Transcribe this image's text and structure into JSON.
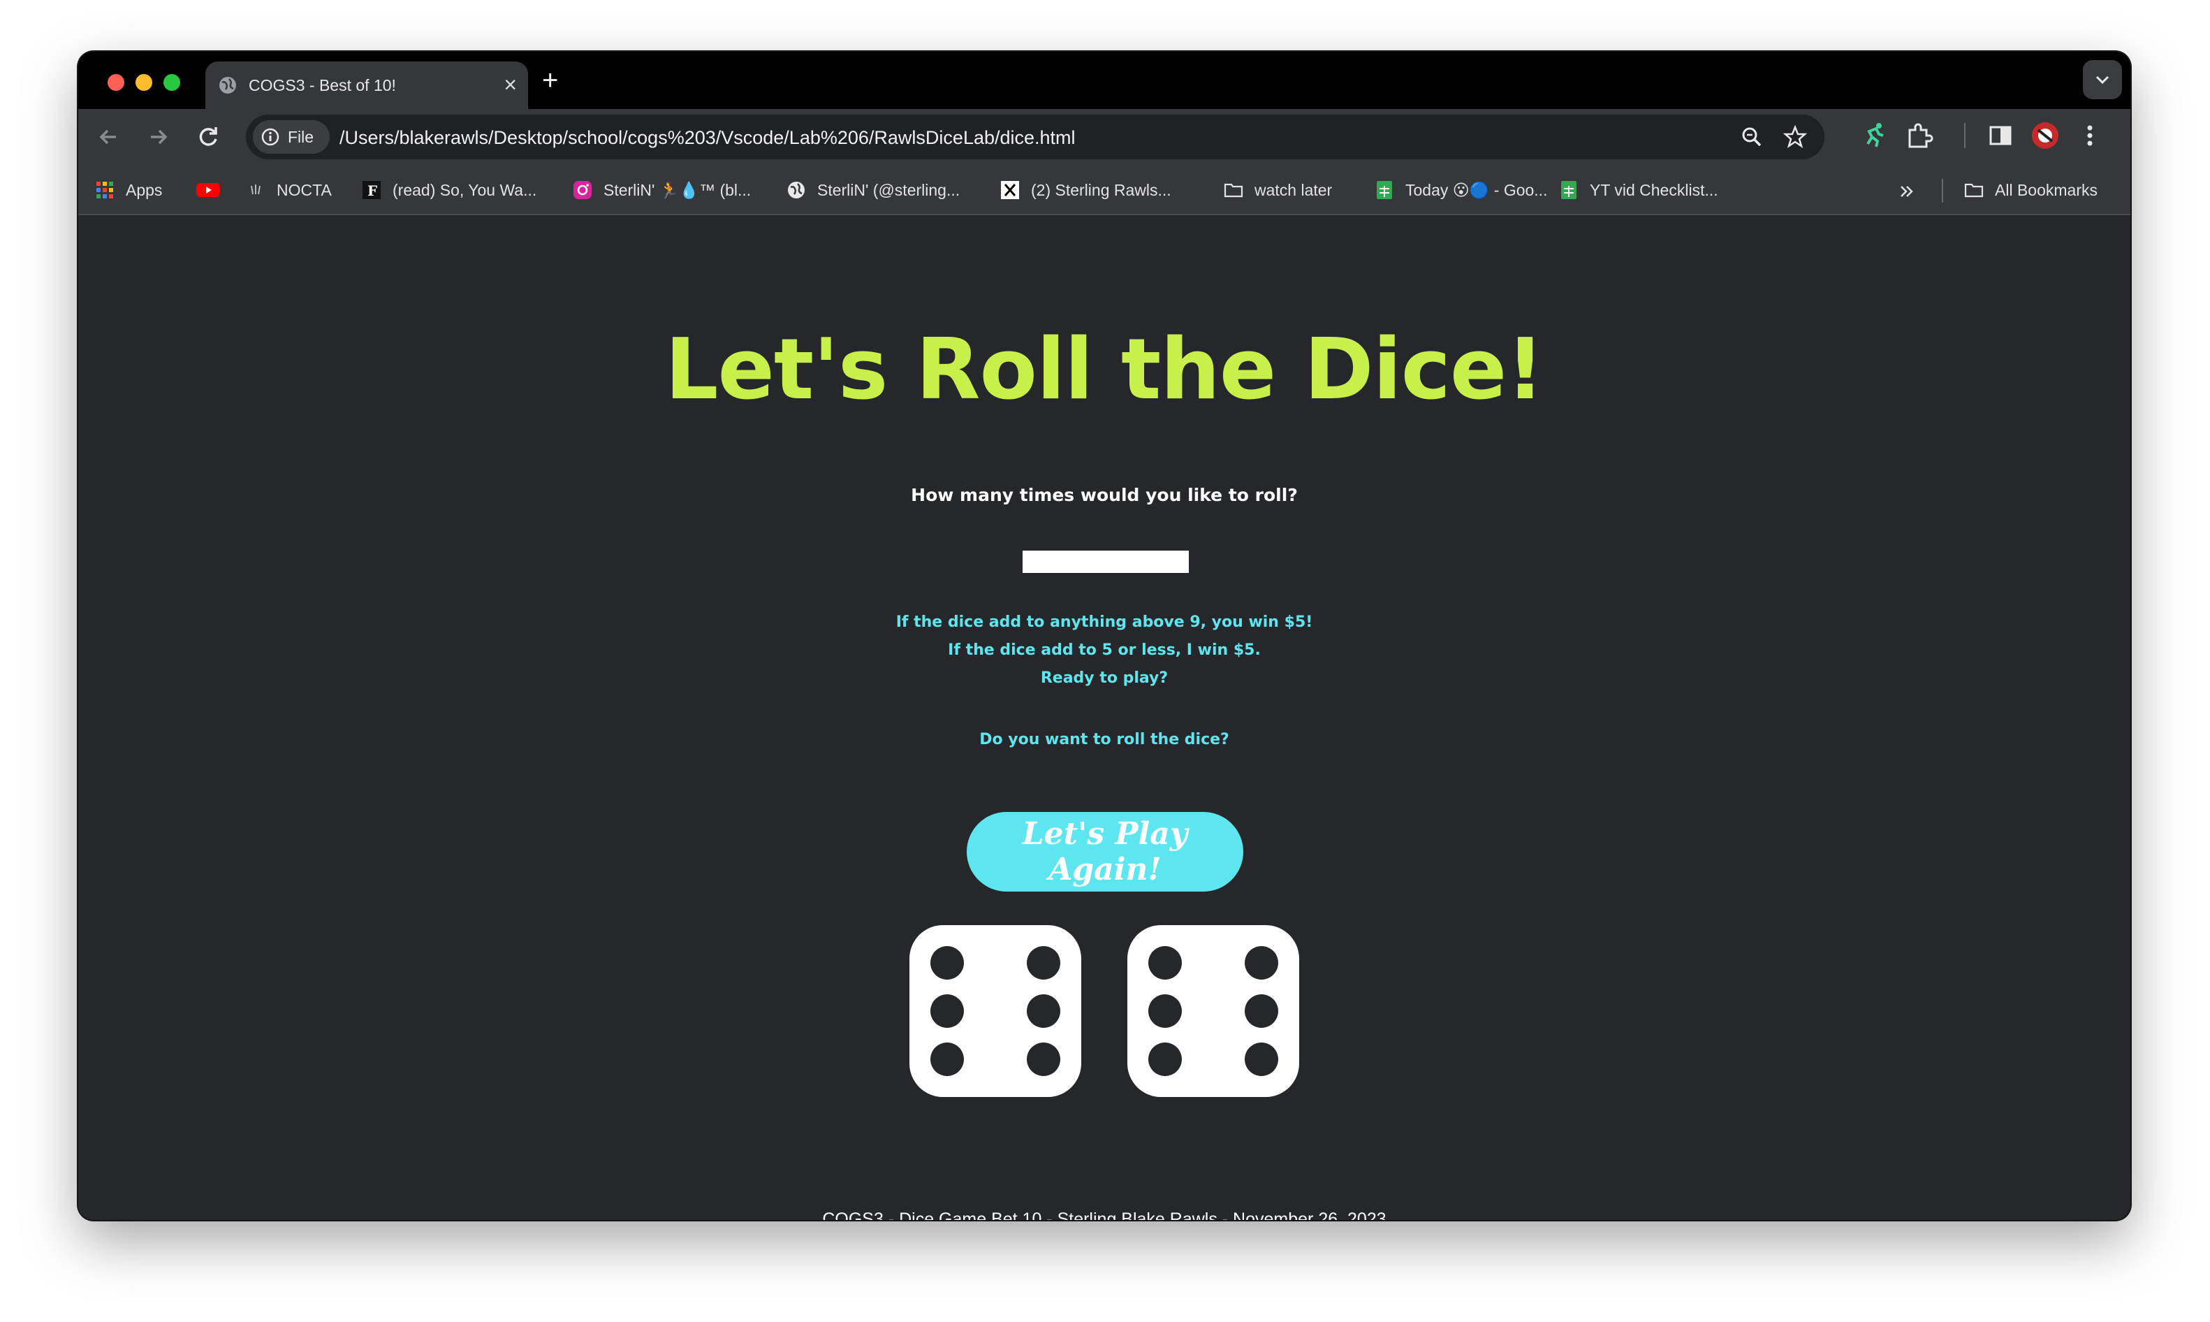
{
  "browser": {
    "tab_title": "COGS3 - Best of 10!",
    "chip_label": "File",
    "url": "/Users/blakerawls/Desktop/school/cogs%203/Vscode/Lab%206/RawlsDiceLab/dice.html"
  },
  "bookmarks": [
    {
      "label": "Apps",
      "icon": "apps-grid-icon"
    },
    {
      "label": "",
      "icon": "youtube-icon"
    },
    {
      "label": "NOCTA",
      "icon": "nocta-icon"
    },
    {
      "label": "(read) So, You Wa...",
      "icon": "f-icon"
    },
    {
      "label": "SterliN' 🏃💧™ (bl...",
      "icon": "instagram-icon"
    },
    {
      "label": "SterliN' (@sterling...",
      "icon": "globe-icon"
    },
    {
      "label": "(2) Sterling Rawls...",
      "icon": "x-icon"
    },
    {
      "label": "watch later",
      "icon": "folder-icon"
    },
    {
      "label": "Today 😮🔵 - Goo...",
      "icon": "sheets-icon"
    },
    {
      "label": "YT vid Checklist...",
      "icon": "sheets-icon"
    }
  ],
  "bookmarks_all": "All Bookmarks",
  "page": {
    "headline": "Let's Roll the Dice!",
    "question": "How many times would you like to roll?",
    "input_value": "",
    "rule_win": "If the dice add to anything above 9, you win $5!",
    "rule_lose": "If the dice add to 5 or less, I win $5.",
    "ready": "Ready to play?",
    "prompt": "Do you want to roll the dice?",
    "play_button": "Let's Play Again!",
    "dice": [
      6,
      6
    ],
    "footer": "COGS3 - Dice Game Bet 10 - Sterling Blake Rawls - November 26, 2023"
  },
  "colors": {
    "headline": "#c8f04a",
    "accent": "#5ee6f0",
    "page_bg": "#26272b"
  }
}
